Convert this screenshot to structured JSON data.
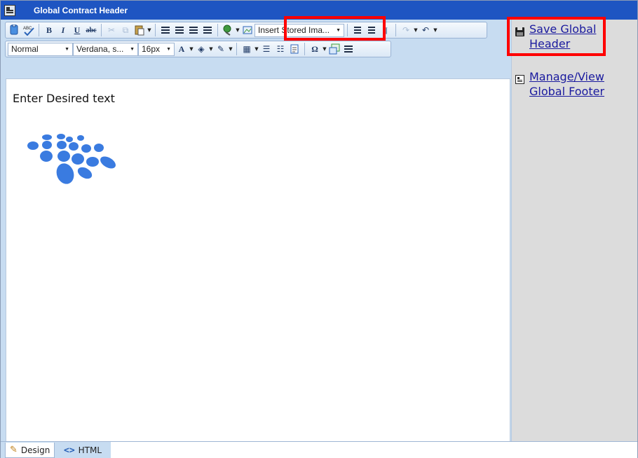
{
  "window": {
    "title": "Global Contract Header"
  },
  "toolbar": {
    "row1": [
      {
        "name": "paste-plain-icon",
        "glyph": "🗎"
      },
      {
        "name": "spellcheck-icon",
        "glyph": "ABC✓"
      },
      {
        "name": "bold-icon",
        "glyph": "B"
      },
      {
        "name": "italic-icon",
        "glyph": "I"
      },
      {
        "name": "underline-icon",
        "glyph": "U"
      },
      {
        "name": "strikethrough-icon",
        "glyph": "abc"
      },
      {
        "name": "cut-icon",
        "glyph": "✂"
      },
      {
        "name": "copy-icon",
        "glyph": "⧉"
      },
      {
        "name": "paste-icon",
        "glyph": "📋"
      },
      {
        "name": "align-left-icon",
        "glyph": ""
      },
      {
        "name": "align-center-icon",
        "glyph": ""
      },
      {
        "name": "align-right-icon",
        "glyph": ""
      },
      {
        "name": "justify-icon",
        "glyph": ""
      },
      {
        "name": "hyperlink-icon",
        "glyph": "🔗"
      },
      {
        "name": "image-manager-icon",
        "glyph": "▣"
      },
      {
        "name": "indent-icon",
        "glyph": "⇥"
      },
      {
        "name": "outdent-icon",
        "glyph": "⇤"
      },
      {
        "name": "paragraph-icon",
        "glyph": "¶"
      },
      {
        "name": "redo-icon",
        "glyph": "↷"
      },
      {
        "name": "undo-icon",
        "glyph": "↶"
      }
    ],
    "insert_stored_image": "Insert Stored Ima...",
    "paragraph_format": "Normal",
    "font_name": "Verdana, s...",
    "font_size": "16px",
    "row2": [
      {
        "name": "font-color-icon",
        "glyph": "A"
      },
      {
        "name": "highlight-color-icon",
        "glyph": "◈"
      },
      {
        "name": "format-painter-icon",
        "glyph": "✎"
      },
      {
        "name": "table-icon",
        "glyph": "▦"
      },
      {
        "name": "bullet-list-icon",
        "glyph": "☰"
      },
      {
        "name": "numbered-list-icon",
        "glyph": "☷"
      },
      {
        "name": "spell-doc-icon",
        "glyph": "📄"
      },
      {
        "name": "special-char-icon",
        "glyph": "Ω"
      },
      {
        "name": "insert-image-icon",
        "glyph": "🖼"
      },
      {
        "name": "horizontal-rule-icon",
        "glyph": "≡"
      }
    ]
  },
  "editor": {
    "content_text": "Enter Desired text",
    "logo_color": "#3a7be0"
  },
  "tabs": {
    "design": "Design",
    "html": "HTML"
  },
  "sidebar": {
    "save_label": "Save Global Header",
    "footer_label": "Manage/View Global Footer"
  },
  "colors": {
    "titlebar": "#1e55c2",
    "toolbar_bg": "#c7dcf1",
    "sidebar_bg": "#dcdcdc",
    "link": "#1a1a9e",
    "highlight": "#ff0000"
  }
}
